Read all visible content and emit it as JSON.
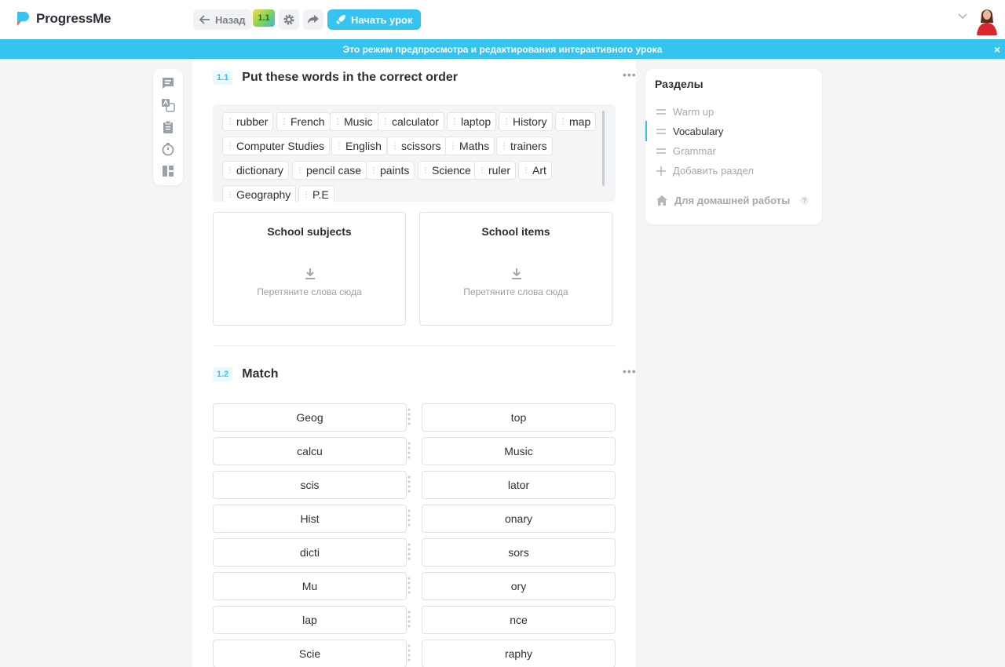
{
  "app": {
    "name": "ProgressMe"
  },
  "topbar": {
    "back_label": "Назад",
    "badge_label": "1.1",
    "start_label": "Начать урок"
  },
  "banner": {
    "text": "Это режим предпросмотра и редактирования интерактивного урока",
    "close": "×"
  },
  "exercise1": {
    "number": "1.1",
    "title": "Put these words in the correct order",
    "menu": "•••",
    "words": [
      "rubber",
      "French",
      "Music",
      "calculator",
      "laptop",
      "History",
      "map",
      "Computer Studies",
      "English",
      "scissors",
      "Maths",
      "trainers",
      "dictionary",
      "pencil case",
      "paints",
      "Science",
      "ruler",
      "Art",
      "Geography",
      "P.E"
    ],
    "categories": [
      {
        "title": "School subjects",
        "hint": "Перетяните слова сюда"
      },
      {
        "title": "School items",
        "hint": "Перетяните слова сюда"
      }
    ]
  },
  "exercise2": {
    "number": "1.2",
    "title": "Match",
    "menu": "•••",
    "left": [
      "Geog",
      "calcu",
      "scis",
      "Hist",
      "dicti",
      "Mu",
      "lap",
      "Scie"
    ],
    "right": [
      "top",
      "Music",
      "lator",
      "onary",
      "sors",
      "ory",
      "nce",
      "raphy"
    ]
  },
  "sections": {
    "title": "Разделы",
    "items": [
      {
        "label": "Warm up",
        "active": false
      },
      {
        "label": "Vocabulary",
        "active": true
      },
      {
        "label": "Grammar",
        "active": false
      }
    ],
    "add_label": "Добавить раздел",
    "homework_label": "Для домашней работы",
    "homework_help": "?"
  },
  "colors": {
    "accent": "#35c4ef",
    "text": "#2c2f36",
    "muted": "#9aa0a8"
  }
}
